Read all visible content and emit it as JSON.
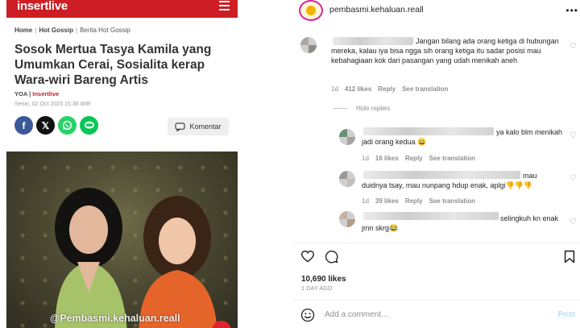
{
  "article": {
    "brand": "insertlive",
    "breadcrumb": {
      "home": "Home",
      "section": "Hot Gossip",
      "current": "Berita Hot Gossip"
    },
    "headline": "Sosok Mertua Tasya Kamila yang Umumkan Cerai, Sosialita kerap Wara-wiri Bareng Artis",
    "author": "YOA",
    "source": "Insertlive",
    "date": "Senin, 02 Oct 2023 15:38 WIB",
    "share_buttons": [
      "facebook-icon",
      "x-icon",
      "whatsapp-icon",
      "line-icon"
    ],
    "komentar_label": "Komentar",
    "watermark": "@Pembasmi.kehaluan.reall"
  },
  "instagram": {
    "username": "pembasmi.kehaluan.reall",
    "comments": [
      {
        "text": "Jangan bilang ada orang ketiga di hubungan mereka, kalau iya bisa ngga sih orang ketiga itu sadar posisi mau kebahagiaan kok dari pasangan yang udah menikah aneh",
        "time": "1d",
        "likes": "412 likes",
        "reply": "Reply",
        "translate": "See translation"
      },
      {
        "text": "ya kalo blm menikah jadi orang kedua 😀",
        "time": "1d",
        "likes": "16 likes",
        "reply": "Reply",
        "translate": "See translation"
      },
      {
        "text": "mau duidnya tsay, mau nunpang hdup enak, aplgi👎👎👎",
        "time": "1d",
        "likes": "39 likes",
        "reply": "Reply",
        "translate": "See translation"
      },
      {
        "text": "selingkuh kn enak jmn skrg😂",
        "time": "",
        "likes": "",
        "reply": "",
        "translate": ""
      }
    ],
    "hide_replies": "Hide replies",
    "likes_count": "10,690 likes",
    "posted_ago": "1 DAY AGO",
    "add_comment_placeholder": "Add a comment...",
    "post_label": "Post"
  }
}
